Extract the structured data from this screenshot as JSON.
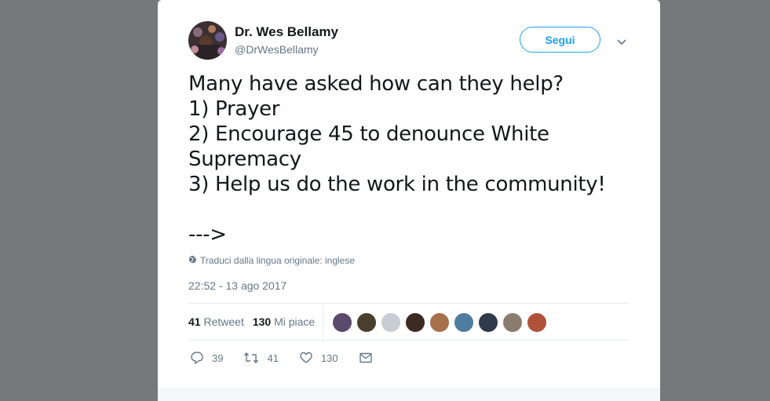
{
  "author": {
    "name": "Dr. Wes Bellamy",
    "handle": "@DrWesBellamy"
  },
  "follow_button": "Segui",
  "tweet": {
    "text": "Many have asked how can they help?\n1) Prayer\n2) Encourage 45 to denounce White Supremacy\n3) Help us do the work in the community!\n\n--->"
  },
  "translate_link": "Traduci dalla lingua originale: inglese",
  "timestamp": "22:52 - 13 ago 2017",
  "stats": {
    "retweets_count": "41",
    "retweets_label": "Retweet",
    "likes_count": "130",
    "likes_label": "Mi piace"
  },
  "likers": [
    {
      "color": "#5a4a6b"
    },
    {
      "color": "#4a3f2c"
    },
    {
      "color": "#c7cdd2"
    },
    {
      "color": "#3b2a22"
    },
    {
      "color": "#a5704a"
    },
    {
      "color": "#4f7da0"
    },
    {
      "color": "#2f3a4a"
    },
    {
      "color": "#8a7c6e"
    },
    {
      "color": "#b0523a"
    }
  ],
  "actions": {
    "replies": "39",
    "retweets": "41",
    "likes": "130"
  }
}
